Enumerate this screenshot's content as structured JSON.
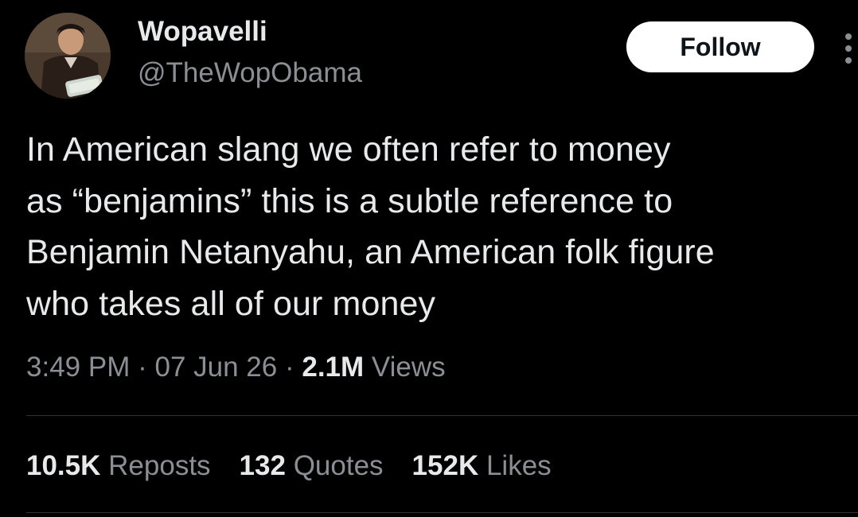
{
  "author": {
    "display_name": "Wopavelli",
    "handle": "@TheWopObama"
  },
  "follow_button": {
    "label": "Follow"
  },
  "tweet": {
    "text": "In American slang we often refer to money\nas “benjamins” this is a subtle reference to\nBenjamin Netanyahu, an American folk figure\nwho takes all of our money"
  },
  "meta": {
    "time": "3:49 PM",
    "separator": "·",
    "date": "07 Jun 26",
    "views_count": "2.1M",
    "views_label": "Views"
  },
  "stats": [
    {
      "count": "10.5K",
      "label": "Reposts"
    },
    {
      "count": "132",
      "label": "Quotes"
    },
    {
      "count": "152K",
      "label": "Likes"
    }
  ],
  "colors": {
    "background": "#000000",
    "primary_text": "#e7e9ea",
    "secondary_text": "#8b8f94",
    "divider": "#2f3336",
    "follow_bg": "#ffffff",
    "follow_text": "#0f1419"
  },
  "icons": {
    "more": "more-vertical-icon",
    "avatar": "user-avatar-photo"
  }
}
